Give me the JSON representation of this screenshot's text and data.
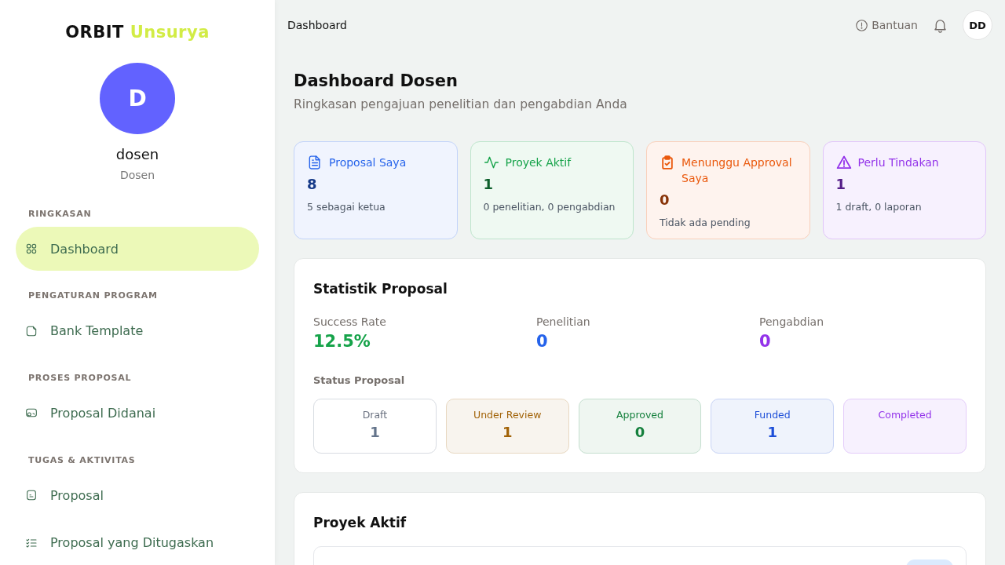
{
  "sidebar": {
    "logo": {
      "primary": "ORBIT",
      "accent": "Unsurya"
    },
    "user": {
      "initial": "D",
      "name": "dosen",
      "role": "Dosen"
    },
    "sections": [
      {
        "heading": "RINGKASAN",
        "items": [
          {
            "label": "Dashboard",
            "selected": true
          }
        ]
      },
      {
        "heading": "PENGATURAN PROGRAM",
        "items": [
          {
            "label": "Bank Template",
            "selected": false
          }
        ]
      },
      {
        "heading": "PROSES PROPOSAL",
        "items": [
          {
            "label": "Proposal Didanai",
            "selected": false
          }
        ]
      },
      {
        "heading": "TUGAS & AKTIVITAS",
        "items": [
          {
            "label": "Proposal",
            "selected": false
          },
          {
            "label": "Proposal yang Ditugaskan",
            "selected": false
          }
        ]
      }
    ]
  },
  "header": {
    "breadcrumb": "Dashboard",
    "help": "Bantuan",
    "avatar": "DD"
  },
  "page": {
    "title": "Dashboard Dosen",
    "subtitle": "Ringkasan pengajuan penelitian dan pengabdian Anda"
  },
  "summary_cards": [
    {
      "title": "Proposal Saya",
      "value": "8",
      "note": "5 sebagai ketua",
      "color": "#2563eb"
    },
    {
      "title": "Proyek Aktif",
      "value": "1",
      "note": "0 penelitian, 0 pengabdian",
      "color": "#16a34a"
    },
    {
      "title": "Menunggu Approval Saya",
      "value": "0",
      "note": "Tidak ada pending",
      "color": "#ea580c"
    },
    {
      "title": "Perlu Tindakan",
      "value": "1",
      "note": "1 draft, 0 laporan",
      "color": "#9333ea"
    }
  ],
  "statistics": {
    "title": "Statistik Proposal",
    "metrics": [
      {
        "label": "Success Rate",
        "value": "12.5%",
        "color": "#16a34a"
      },
      {
        "label": "Penelitian",
        "value": "0",
        "color": "#2563eb"
      },
      {
        "label": "Pengabdian",
        "value": "0",
        "color": "#9333ea"
      }
    ],
    "status_title": "Status Proposal",
    "statuses": [
      {
        "label": "Draft",
        "value": "1",
        "color": "#64748b"
      },
      {
        "label": "Under Review",
        "value": "1",
        "color": "#a16207"
      },
      {
        "label": "Approved",
        "value": "0",
        "color": "#15803d"
      },
      {
        "label": "Funded",
        "value": "1",
        "color": "#1d4ed8"
      },
      {
        "label": "Completed",
        "color": "#9333ea"
      }
    ]
  },
  "active_projects": {
    "title": "Proyek Aktif"
  }
}
